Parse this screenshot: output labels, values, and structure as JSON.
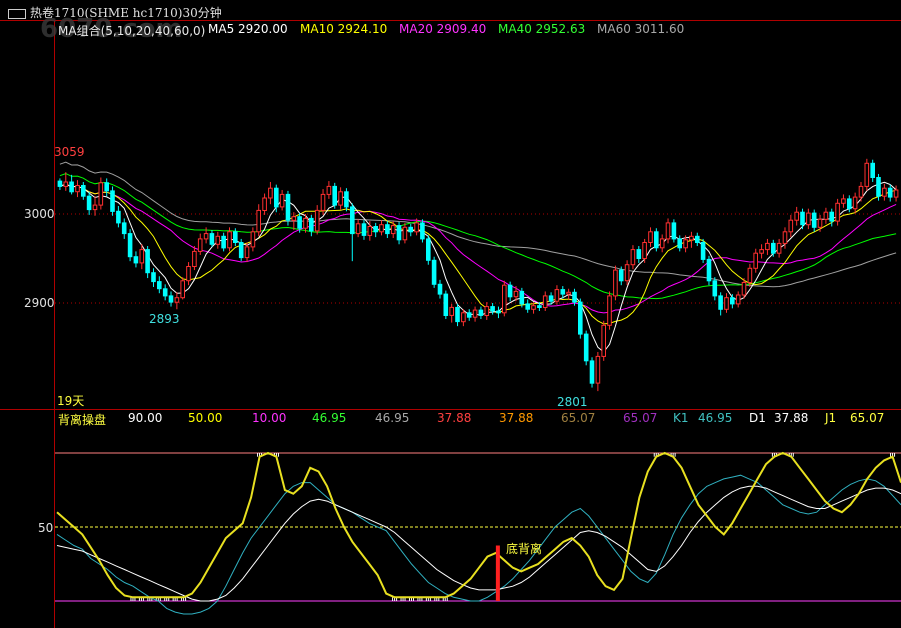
{
  "header": {
    "title": "热卷1710(SHME hc1710)30分钟",
    "logo_text": "6070.com"
  },
  "ma_legend": {
    "group_label": "MA组合(5,10,20,40,60,0)",
    "ma5": "MA5 2920.00",
    "ma10": "MA10 2924.10",
    "ma20": "MA20 2909.40",
    "ma40": "MA40 2952.63",
    "ma60": "MA60 3011.60"
  },
  "indicator_legend": {
    "name": "背离操盘",
    "v1": "90.00",
    "v2": "50.00",
    "v3": "10.00",
    "v4": "46.95",
    "v5": "46.95",
    "v6": "37.88",
    "v7": "37.88",
    "v8": "65.07",
    "v9": "65.07",
    "k1": "K1",
    "k1v": "46.95",
    "d1": "D1",
    "d1v": "37.88",
    "j1": "J1",
    "j1v": "65.07"
  },
  "annotations": {
    "high_label": "3059",
    "low_label_1": "2893",
    "low_label_2": "2801",
    "days_label": "19天",
    "divergence_label": "底背离"
  },
  "axis": {
    "p3000": "3000",
    "p2900": "2900",
    "ind50": "50"
  },
  "colors": {
    "ma5": "#ffffff",
    "ma10": "#ffff00",
    "ma20": "#ff00ff",
    "ma40": "#00ff00",
    "ma60": "#a0a0a0",
    "up": "#ff3030",
    "down": "#00ffff",
    "frame": "#b00000"
  },
  "chart_data": [
    {
      "type": "candlestick",
      "title": "热卷1710(SHME hc1710)30分钟",
      "ylim": [
        2780,
        3120
      ],
      "yticks": [
        2900,
        3000
      ],
      "labeled_extremes": {
        "high": 3059,
        "low_1": 2893,
        "low_2": 2801
      },
      "candles": [
        [
          3037,
          3040,
          3027,
          3031
        ],
        [
          3031,
          3047,
          3026,
          3036
        ],
        [
          3036,
          3044,
          3022,
          3025
        ],
        [
          3025,
          3038,
          3019,
          3032
        ],
        [
          3032,
          3036,
          3016,
          3020
        ],
        [
          3020,
          3025,
          2999,
          3005
        ],
        [
          3005,
          3020,
          2998,
          3010
        ],
        [
          3010,
          3041,
          3005,
          3035
        ],
        [
          3035,
          3040,
          3020,
          3026
        ],
        [
          3026,
          3031,
          2998,
          3003
        ],
        [
          3003,
          3009,
          2985,
          2990
        ],
        [
          2990,
          2995,
          2972,
          2978
        ],
        [
          2978,
          2983,
          2947,
          2952
        ],
        [
          2952,
          2958,
          2940,
          2945
        ],
        [
          2945,
          2966,
          2938,
          2960
        ],
        [
          2960,
          2964,
          2928,
          2934
        ],
        [
          2934,
          2939,
          2918,
          2924
        ],
        [
          2924,
          2930,
          2911,
          2916
        ],
        [
          2916,
          2921,
          2903,
          2908
        ],
        [
          2908,
          2913,
          2896,
          2901
        ],
        [
          2901,
          2912,
          2893,
          2906
        ],
        [
          2906,
          2929,
          2904,
          2925
        ],
        [
          2925,
          2946,
          2920,
          2941
        ],
        [
          2941,
          2964,
          2937,
          2958
        ],
        [
          2958,
          2978,
          2954,
          2972
        ],
        [
          2972,
          2985,
          2967,
          2978
        ],
        [
          2978,
          2982,
          2963,
          2966
        ],
        [
          2966,
          2980,
          2961,
          2975
        ],
        [
          2975,
          2979,
          2958,
          2962
        ],
        [
          2962,
          2985,
          2958,
          2980
        ],
        [
          2980,
          2984,
          2964,
          2968
        ],
        [
          2968,
          2972,
          2947,
          2951
        ],
        [
          2951,
          2968,
          2946,
          2963
        ],
        [
          2963,
          2985,
          2958,
          2980
        ],
        [
          2980,
          3011,
          2975,
          3004
        ],
        [
          3004,
          3023,
          2999,
          3018
        ],
        [
          3018,
          3036,
          3011,
          3029
        ],
        [
          3029,
          3033,
          3002,
          3008
        ],
        [
          3008,
          3027,
          3004,
          3022
        ],
        [
          3022,
          3026,
          2987,
          2993
        ],
        [
          2993,
          3002,
          2982,
          2997
        ],
        [
          2997,
          3001,
          2979,
          2984
        ],
        [
          2984,
          3000,
          2979,
          2995
        ],
        [
          2995,
          2999,
          2975,
          2981
        ],
        [
          2981,
          3010,
          2977,
          3004
        ],
        [
          3004,
          3028,
          2999,
          3022
        ],
        [
          3022,
          3037,
          3017,
          3031
        ],
        [
          3031,
          3035,
          3006,
          3010
        ],
        [
          3010,
          3030,
          3005,
          3025
        ],
        [
          3025,
          3029,
          3003,
          3008
        ],
        [
          3008,
          3012,
          2947,
          2978
        ],
        [
          2978,
          2994,
          2974,
          2989
        ],
        [
          2989,
          2993,
          2971,
          2976
        ],
        [
          2976,
          2992,
          2970,
          2986
        ],
        [
          2986,
          2990,
          2974,
          2980
        ],
        [
          2980,
          2993,
          2976,
          2988
        ],
        [
          2988,
          2992,
          2973,
          2978
        ],
        [
          2978,
          2992,
          2973,
          2987
        ],
        [
          2987,
          2991,
          2966,
          2971
        ],
        [
          2971,
          2990,
          2967,
          2985
        ],
        [
          2985,
          2989,
          2975,
          2980
        ],
        [
          2980,
          2995,
          2976,
          2990
        ],
        [
          2990,
          2994,
          2968,
          2972
        ],
        [
          2972,
          2976,
          2943,
          2948
        ],
        [
          2948,
          2952,
          2917,
          2921
        ],
        [
          2921,
          2926,
          2905,
          2910
        ],
        [
          2910,
          2914,
          2882,
          2886
        ],
        [
          2886,
          2899,
          2878,
          2895
        ],
        [
          2895,
          2899,
          2874,
          2879
        ],
        [
          2879,
          2893,
          2874,
          2889
        ],
        [
          2889,
          2893,
          2880,
          2884
        ],
        [
          2884,
          2896,
          2879,
          2892
        ],
        [
          2892,
          2896,
          2882,
          2886
        ],
        [
          2886,
          2901,
          2881,
          2896
        ],
        [
          2896,
          2900,
          2887,
          2891
        ],
        [
          2891,
          2896,
          2883,
          2889
        ],
        [
          2889,
          2925,
          2885,
          2920
        ],
        [
          2920,
          2924,
          2902,
          2907
        ],
        [
          2907,
          2919,
          2902,
          2913
        ],
        [
          2913,
          2917,
          2895,
          2899
        ],
        [
          2899,
          2904,
          2889,
          2893
        ],
        [
          2893,
          2901,
          2888,
          2897
        ],
        [
          2897,
          2901,
          2891,
          2895
        ],
        [
          2895,
          2913,
          2891,
          2908
        ],
        [
          2908,
          2912,
          2898,
          2902
        ],
        [
          2902,
          2920,
          2898,
          2915
        ],
        [
          2915,
          2919,
          2905,
          2910
        ],
        [
          2910,
          2916,
          2904,
          2912
        ],
        [
          2912,
          2916,
          2897,
          2901
        ],
        [
          2901,
          2905,
          2860,
          2865
        ],
        [
          2865,
          2869,
          2830,
          2835
        ],
        [
          2835,
          2839,
          2805,
          2810
        ],
        [
          2810,
          2845,
          2801,
          2840
        ],
        [
          2840,
          2880,
          2835,
          2875
        ],
        [
          2875,
          2913,
          2870,
          2908
        ],
        [
          2908,
          2942,
          2903,
          2937
        ],
        [
          2937,
          2941,
          2920,
          2925
        ],
        [
          2925,
          2948,
          2920,
          2943
        ],
        [
          2943,
          2965,
          2938,
          2960
        ],
        [
          2960,
          2964,
          2945,
          2950
        ],
        [
          2950,
          2972,
          2945,
          2968
        ],
        [
          2968,
          2985,
          2963,
          2980
        ],
        [
          2980,
          2984,
          2958,
          2962
        ],
        [
          2962,
          2977,
          2957,
          2972
        ],
        [
          2972,
          2995,
          2967,
          2990
        ],
        [
          2990,
          2994,
          2968,
          2972
        ],
        [
          2972,
          2976,
          2958,
          2962
        ],
        [
          2962,
          2976,
          2957,
          2971
        ],
        [
          2971,
          2980,
          2962,
          2975
        ],
        [
          2975,
          2979,
          2964,
          2968
        ],
        [
          2968,
          2972,
          2945,
          2949
        ],
        [
          2949,
          2953,
          2920,
          2925
        ],
        [
          2925,
          2929,
          2903,
          2908
        ],
        [
          2908,
          2912,
          2886,
          2893
        ],
        [
          2893,
          2911,
          2889,
          2906
        ],
        [
          2906,
          2910,
          2894,
          2899
        ],
        [
          2899,
          2913,
          2895,
          2909
        ],
        [
          2909,
          2928,
          2905,
          2923
        ],
        [
          2923,
          2944,
          2918,
          2939
        ],
        [
          2939,
          2961,
          2934,
          2956
        ],
        [
          2956,
          2966,
          2950,
          2960
        ],
        [
          2960,
          2972,
          2954,
          2967
        ],
        [
          2967,
          2971,
          2952,
          2956
        ],
        [
          2956,
          2972,
          2951,
          2967
        ],
        [
          2967,
          2985,
          2961,
          2980
        ],
        [
          2980,
          2999,
          2974,
          2993
        ],
        [
          2993,
          3008,
          2987,
          3002
        ],
        [
          3002,
          3006,
          2983,
          2988
        ],
        [
          2988,
          3006,
          2983,
          3001
        ],
        [
          3001,
          3005,
          2980,
          2985
        ],
        [
          2985,
          2999,
          2980,
          2994
        ],
        [
          2994,
          3007,
          2989,
          3002
        ],
        [
          3002,
          3006,
          2986,
          2992
        ],
        [
          2992,
          3017,
          2987,
          3012
        ],
        [
          3012,
          3022,
          3007,
          3017
        ],
        [
          3017,
          3021,
          3002,
          3006
        ],
        [
          3006,
          3024,
          3001,
          3019
        ],
        [
          3019,
          3036,
          3014,
          3031
        ],
        [
          3031,
          3062,
          3026,
          3057
        ],
        [
          3057,
          3061,
          3036,
          3041
        ],
        [
          3041,
          3045,
          3015,
          3020
        ],
        [
          3020,
          3034,
          3015,
          3029
        ],
        [
          3029,
          3033,
          3014,
          3019
        ],
        [
          3019,
          3032,
          3014,
          3027
        ]
      ]
    },
    {
      "type": "line",
      "title": "背离操盘",
      "ylim": [
        0,
        100
      ],
      "yticks": [
        50
      ],
      "reference_lines": [
        90,
        50,
        10
      ],
      "series": [
        {
          "name": "K1",
          "values": [
            46,
            43,
            40,
            38,
            33,
            30,
            27,
            23,
            20,
            18,
            15,
            12,
            10,
            6,
            4,
            3,
            3,
            4,
            6,
            10,
            18,
            27,
            36,
            44,
            50,
            56,
            62,
            68,
            72,
            74,
            74,
            70,
            66,
            62,
            60,
            58,
            55,
            52,
            50,
            48,
            42,
            36,
            30,
            25,
            20,
            17,
            14,
            12,
            11,
            10,
            10,
            12,
            15,
            18,
            22,
            27,
            32,
            38,
            44,
            50,
            54,
            58,
            60,
            56,
            50,
            44,
            38,
            32,
            26,
            22,
            20,
            25,
            35,
            46,
            55,
            62,
            68,
            72,
            74,
            76,
            77,
            78,
            76,
            74,
            70,
            66,
            62,
            60,
            58,
            57,
            58,
            62,
            66,
            70,
            73,
            75,
            76,
            75,
            72,
            67,
            62
          ]
        },
        {
          "name": "D1",
          "values": [
            40,
            39,
            38,
            37,
            35,
            33,
            31,
            29,
            27,
            25,
            23,
            21,
            19,
            17,
            15,
            13,
            11,
            10,
            10,
            11,
            13,
            17,
            22,
            28,
            34,
            40,
            46,
            52,
            57,
            61,
            64,
            65,
            64,
            62,
            60,
            58,
            56,
            54,
            52,
            50,
            47,
            43,
            39,
            35,
            31,
            27,
            24,
            21,
            19,
            17,
            16,
            16,
            16,
            17,
            18,
            20,
            23,
            27,
            31,
            35,
            39,
            43,
            47,
            48,
            47,
            45,
            42,
            39,
            35,
            31,
            27,
            26,
            29,
            34,
            40,
            47,
            53,
            58,
            62,
            66,
            69,
            71,
            72,
            72,
            71,
            69,
            67,
            65,
            63,
            61,
            60,
            60,
            62,
            64,
            66,
            68,
            70,
            71,
            71,
            70,
            68
          ]
        },
        {
          "name": "J1",
          "values": [
            58,
            54,
            50,
            46,
            39,
            32,
            24,
            17,
            13,
            12,
            12,
            12,
            12,
            12,
            12,
            12,
            14,
            20,
            28,
            36,
            44,
            48,
            52,
            66,
            88,
            90,
            88,
            70,
            68,
            72,
            82,
            80,
            72,
            60,
            50,
            42,
            36,
            30,
            24,
            14,
            12,
            12,
            12,
            12,
            12,
            12,
            12,
            14,
            18,
            22,
            28,
            34,
            36,
            32,
            28,
            26,
            28,
            30,
            34,
            38,
            42,
            44,
            40,
            34,
            24,
            18,
            16,
            22,
            44,
            66,
            80,
            88,
            90,
            88,
            82,
            72,
            62,
            56,
            50,
            46,
            52,
            60,
            68,
            76,
            84,
            88,
            90,
            88,
            82,
            76,
            70,
            64,
            60,
            58,
            62,
            68,
            76,
            82,
            86,
            88,
            74
          ]
        }
      ],
      "markers": [
        {
          "label": "底背离",
          "index": 52
        }
      ]
    }
  ]
}
